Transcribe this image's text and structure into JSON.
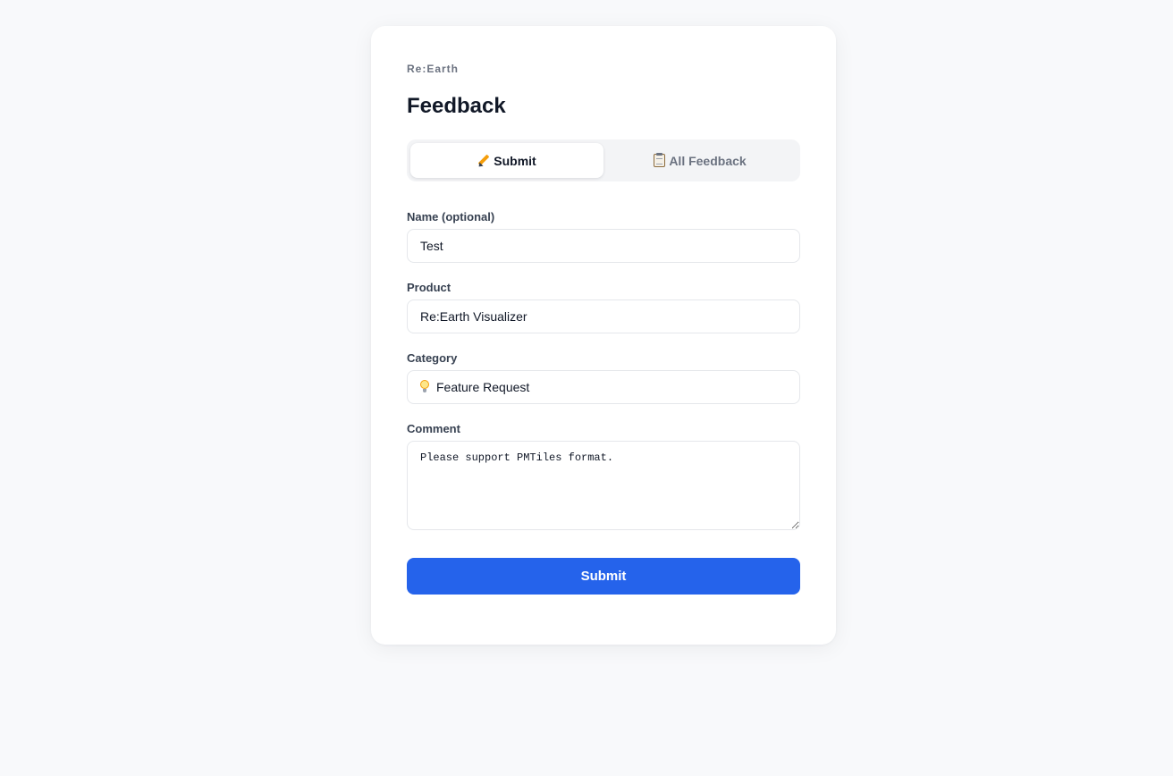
{
  "brand": "Re:Earth",
  "page_title": "Feedback",
  "tabs": [
    {
      "label": "Submit",
      "icon": "pencil-icon",
      "active": true
    },
    {
      "label": "All Feedback",
      "icon": "clipboard-icon",
      "active": false
    }
  ],
  "form": {
    "name": {
      "label": "Name (optional)",
      "value": "Test"
    },
    "product": {
      "label": "Product",
      "value": "Re:Earth Visualizer"
    },
    "category": {
      "label": "Category",
      "value": "Feature Request",
      "icon": "lightbulb-icon"
    },
    "comment": {
      "label": "Comment",
      "value": "Please support PMTiles format."
    },
    "submit_label": "Submit"
  },
  "colors": {
    "accent": "#2563eb",
    "background": "#f8f9fb",
    "card": "#ffffff"
  }
}
